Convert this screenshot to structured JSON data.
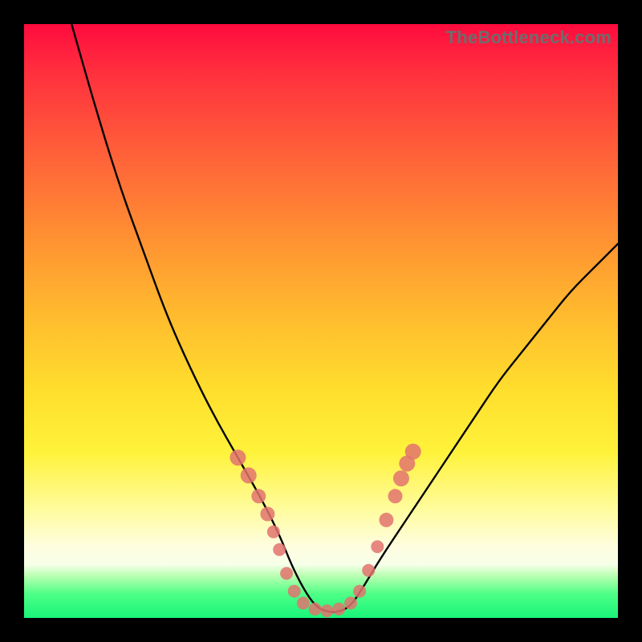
{
  "watermark": "TheBottleneck.com",
  "chart_data": {
    "type": "line",
    "title": "",
    "xlabel": "",
    "ylabel": "",
    "xlim": [
      0,
      100
    ],
    "ylim": [
      0,
      100
    ],
    "gradient_bands": [
      {
        "name": "red",
        "from_pct": 0,
        "to_pct": 30
      },
      {
        "name": "orange",
        "from_pct": 30,
        "to_pct": 60
      },
      {
        "name": "yellow",
        "from_pct": 60,
        "to_pct": 85
      },
      {
        "name": "cream",
        "from_pct": 85,
        "to_pct": 92
      },
      {
        "name": "green",
        "from_pct": 92,
        "to_pct": 100
      }
    ],
    "series": [
      {
        "name": "bottleneck-curve",
        "note": "V-shaped curve; values are approximate percentages read off the vertical gradient (0 = top, 100 = bottom)",
        "x": [
          8,
          12,
          16,
          20,
          24,
          28,
          32,
          36,
          40,
          43,
          45,
          47,
          49,
          51,
          53,
          55,
          57,
          60,
          64,
          68,
          72,
          76,
          80,
          84,
          88,
          92,
          96,
          100
        ],
        "y_pct": [
          0,
          14,
          27,
          38,
          49,
          58,
          66,
          73,
          80,
          86,
          91,
          95,
          98,
          99,
          99,
          98,
          95,
          90,
          84,
          78,
          72,
          66,
          60,
          55,
          50,
          45,
          41,
          37
        ]
      }
    ],
    "markers": {
      "note": "salmon dots along the curve near the flat bottom region; coords in same 0–100 space as series",
      "color": "#e2736f",
      "points": [
        {
          "x": 36.0,
          "y_pct": 73.0,
          "r": 2.0
        },
        {
          "x": 37.8,
          "y_pct": 76.0,
          "r": 2.0
        },
        {
          "x": 39.5,
          "y_pct": 79.5,
          "r": 1.8
        },
        {
          "x": 41.0,
          "y_pct": 82.5,
          "r": 1.8
        },
        {
          "x": 42.0,
          "y_pct": 85.5,
          "r": 1.6
        },
        {
          "x": 43.0,
          "y_pct": 88.5,
          "r": 1.6
        },
        {
          "x": 44.2,
          "y_pct": 92.5,
          "r": 1.6
        },
        {
          "x": 45.5,
          "y_pct": 95.5,
          "r": 1.6
        },
        {
          "x": 47.0,
          "y_pct": 97.5,
          "r": 1.6
        },
        {
          "x": 49.0,
          "y_pct": 98.5,
          "r": 1.6
        },
        {
          "x": 51.0,
          "y_pct": 98.8,
          "r": 1.6
        },
        {
          "x": 53.0,
          "y_pct": 98.5,
          "r": 1.6
        },
        {
          "x": 55.0,
          "y_pct": 97.5,
          "r": 1.6
        },
        {
          "x": 56.5,
          "y_pct": 95.5,
          "r": 1.6
        },
        {
          "x": 58.0,
          "y_pct": 92.0,
          "r": 1.6
        },
        {
          "x": 59.5,
          "y_pct": 88.0,
          "r": 1.6
        },
        {
          "x": 61.0,
          "y_pct": 83.5,
          "r": 1.8
        },
        {
          "x": 62.5,
          "y_pct": 79.5,
          "r": 1.8
        },
        {
          "x": 63.5,
          "y_pct": 76.5,
          "r": 2.0
        },
        {
          "x": 64.5,
          "y_pct": 74.0,
          "r": 2.0
        },
        {
          "x": 65.5,
          "y_pct": 72.0,
          "r": 2.0
        }
      ]
    }
  }
}
